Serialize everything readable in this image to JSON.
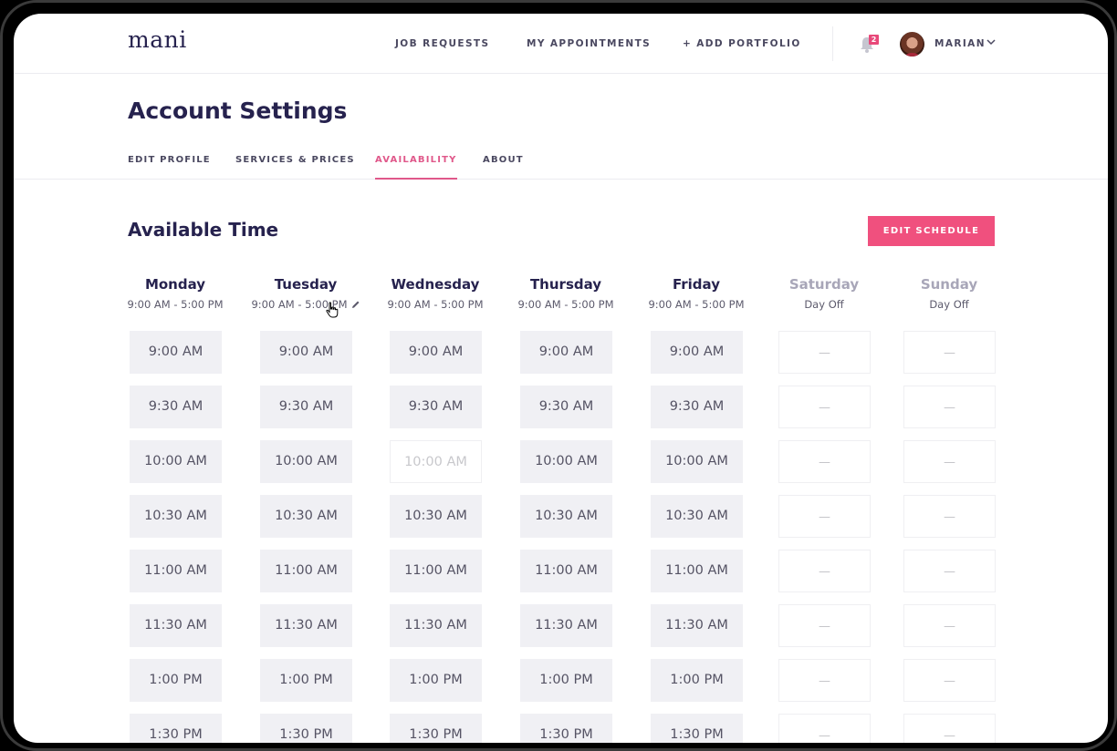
{
  "brand": {
    "logo": "mani",
    "accent_color": "#f0507e"
  },
  "topnav": {
    "links": [
      "JOB REQUESTS",
      "MY APPOINTMENTS",
      "+ ADD PORTFOLIO"
    ],
    "notification_count": "2",
    "user_name": "MARIAN"
  },
  "page": {
    "title": "Account Settings",
    "tabs": [
      "EDIT PROFILE",
      "SERVICES & PRICES",
      "AVAILABILITY",
      "ABOUT"
    ],
    "active_tab": "AVAILABILITY"
  },
  "availability": {
    "title": "Available Time",
    "edit_button": "EDIT SCHEDULE",
    "off_placeholder": "—",
    "days": [
      {
        "name": "Monday",
        "hours": "9:00 AM - 5:00 PM",
        "off": false,
        "unavailable": []
      },
      {
        "name": "Tuesday",
        "hours": "9:00 AM - 5:00 PM",
        "off": false,
        "unavailable": []
      },
      {
        "name": "Wednesday",
        "hours": "9:00 AM - 5:00 PM",
        "off": false,
        "unavailable": [
          "10:00 AM"
        ]
      },
      {
        "name": "Thursday",
        "hours": "9:00 AM - 5:00 PM",
        "off": false,
        "unavailable": []
      },
      {
        "name": "Friday",
        "hours": "9:00 AM - 5:00 PM",
        "off": false,
        "unavailable": []
      },
      {
        "name": "Saturday",
        "hours": "Day Off",
        "off": true,
        "unavailable": []
      },
      {
        "name": "Sunday",
        "hours": "Day Off",
        "off": true,
        "unavailable": []
      }
    ],
    "slots": [
      "9:00 AM",
      "9:30 AM",
      "10:00 AM",
      "10:30 AM",
      "11:00 AM",
      "11:30 AM",
      "1:00 PM",
      "1:30 PM"
    ]
  }
}
